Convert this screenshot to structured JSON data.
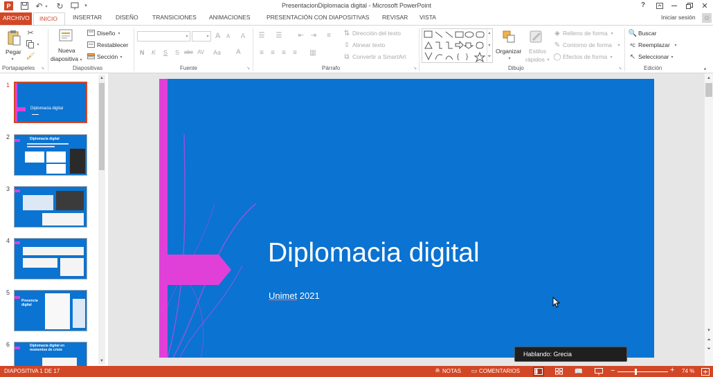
{
  "titlebar": {
    "title": "PresentacionDiplomacia digital - Microsoft PowerPoint",
    "help": "?"
  },
  "tabs": {
    "file": "ARCHIVO",
    "items": [
      "INICIO",
      "INSERTAR",
      "DISEÑO",
      "TRANSICIONES",
      "ANIMACIONES",
      "PRESENTACIÓN CON DIAPOSITIVAS",
      "REVISAR",
      "VISTA"
    ],
    "signin": "Iniciar sesión"
  },
  "ribbon": {
    "clipboard": {
      "paste": "Pegar",
      "group": "Portapapeles"
    },
    "slides": {
      "new_slide_1": "Nueva",
      "new_slide_2": "diapositiva",
      "design": "Diseño",
      "reset": "Restablecer",
      "section": "Sección",
      "group": "Diapositivas"
    },
    "font": {
      "group": "Fuente",
      "b": "N",
      "i": "K",
      "u": "S",
      "s": "S",
      "strike": "abc",
      "spacing": "AV",
      "case": "Aa",
      "color": "A",
      "grow": "A",
      "shrink": "A"
    },
    "paragraph": {
      "direction": "Dirección del texto",
      "align": "Alinear texto",
      "smartart": "Convertir a SmartArt",
      "group": "Párrafo"
    },
    "drawing": {
      "arrange": "Organizar",
      "styles_1": "Estilos",
      "styles_2": "rápidos",
      "fill": "Relleno de forma",
      "outline": "Contorno de forma",
      "effects": "Efectos de forma",
      "group": "Dibujo"
    },
    "editing": {
      "find": "Buscar",
      "replace": "Reemplazar",
      "select": "Seleccionar",
      "group": "Edición"
    }
  },
  "thumbnails": [
    {
      "n": "1",
      "title": "Diplomacia digital"
    },
    {
      "n": "2",
      "title": "Diplomacia digital"
    },
    {
      "n": "3",
      "title": ""
    },
    {
      "n": "4",
      "title": ""
    },
    {
      "n": "5",
      "title": "Presencia digital"
    },
    {
      "n": "6",
      "title": "Diplomacia digital en momentos de crisis"
    }
  ],
  "slide": {
    "title": "Diplomacia digital",
    "subtitle_word": "Unimet",
    "subtitle_year": " 2021",
    "bg_color": "#0b73d1",
    "accent_color": "#e040d8"
  },
  "tooltip": {
    "speaking": "Hablando: Grecia"
  },
  "status": {
    "slide_info": "DIAPOSITIVA 1 DE 17",
    "notes": "NOTAS",
    "comments": "COMENTARIOS",
    "zoom": "74 %",
    "color": "#d24726"
  }
}
